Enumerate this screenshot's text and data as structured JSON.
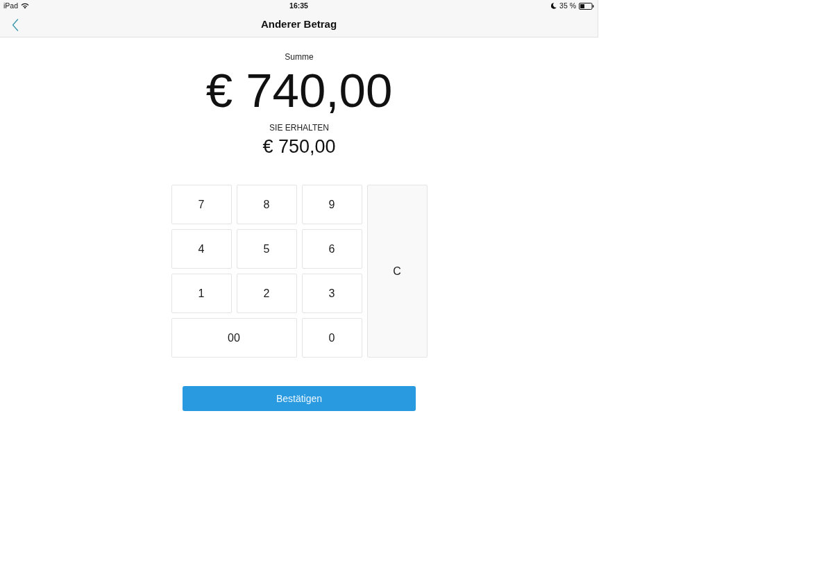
{
  "status_bar": {
    "device": "iPad",
    "time": "16:35",
    "battery": "35 %"
  },
  "nav_bar": {
    "title": "Anderer Betrag"
  },
  "total": {
    "label": "Summe",
    "amount": "€ 740,00"
  },
  "received": {
    "label": "SIE ERHALTEN",
    "amount": "€ 750,00"
  },
  "keypad": {
    "keys": [
      {
        "label": "7",
        "kind": "digit"
      },
      {
        "label": "8",
        "kind": "digit"
      },
      {
        "label": "9",
        "kind": "digit"
      },
      {
        "label": "C",
        "kind": "clear"
      },
      {
        "label": "4",
        "kind": "digit"
      },
      {
        "label": "5",
        "kind": "digit"
      },
      {
        "label": "6",
        "kind": "digit"
      },
      {
        "label": "1",
        "kind": "digit"
      },
      {
        "label": "2",
        "kind": "digit"
      },
      {
        "label": "3",
        "kind": "digit"
      },
      {
        "label": "00",
        "kind": "wide"
      },
      {
        "label": "0",
        "kind": "digit"
      }
    ]
  },
  "confirm_button": {
    "label": "Bestätigen"
  }
}
